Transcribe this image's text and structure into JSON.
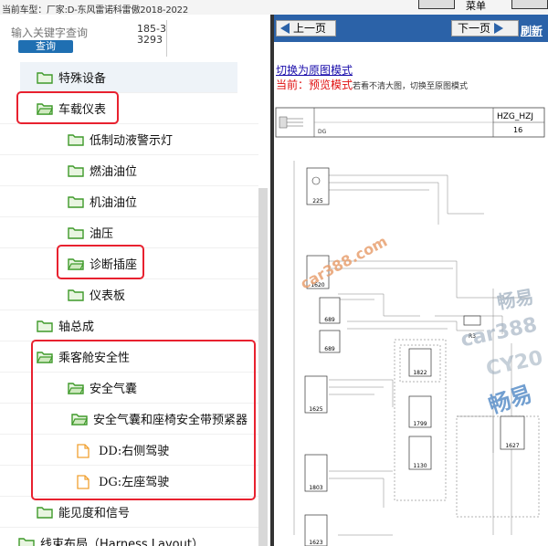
{
  "header": {
    "car_model": "当前车型：厂家:D-东风雷诺科雷傲2018-2022",
    "top_right_label": "菜单"
  },
  "search": {
    "placeholder": "输入关键字查询",
    "button_label": "查询",
    "phone": "185-33293"
  },
  "tree": {
    "items": [
      {
        "label": "特殊设备"
      },
      {
        "label": "车载仪表"
      },
      {
        "label": "低制动液警示灯"
      },
      {
        "label": "燃油油位"
      },
      {
        "label": "机油油位"
      },
      {
        "label": "油压"
      },
      {
        "label": "诊断插座"
      },
      {
        "label": "仪表板"
      },
      {
        "label": "轴总成"
      },
      {
        "label": "乘客舱安全性"
      },
      {
        "label": "安全气囊"
      },
      {
        "label": "安全气囊和座椅安全带预紧器"
      },
      {
        "label": "DD:右侧驾驶"
      },
      {
        "label": "DG:左座驾驶"
      },
      {
        "label": "能见度和信号"
      },
      {
        "label": "线束布局（Harness Layout）"
      }
    ]
  },
  "viewer": {
    "prev_label": "上一页",
    "next_label": "下一页",
    "refresh_label": "刷新",
    "switch_link": "切换为原图模式",
    "current_key": "当前：",
    "current_value": "预览模式",
    "current_hint": "若看不清大图，切换至原图模式"
  },
  "diagram": {
    "title_code": "HZG_HZJ",
    "title_num": "16",
    "title_dg": "DG",
    "components": [
      "225",
      "1620",
      "689",
      "689",
      "R3",
      "1822",
      "1625",
      "1799",
      "1627",
      "1803",
      "1130",
      "1623"
    ],
    "watermarks": [
      "car388.com",
      "畅易",
      "car388",
      "CY20",
      "畅易"
    ]
  },
  "colors": {
    "accent_blue": "#2b62a8",
    "highlight_red": "#e8212f",
    "folder_green": "#3f9a2a",
    "file_orange": "#f0a030",
    "watermark_orange": "#e8a070",
    "watermark_blue": "#5a8fc8"
  }
}
